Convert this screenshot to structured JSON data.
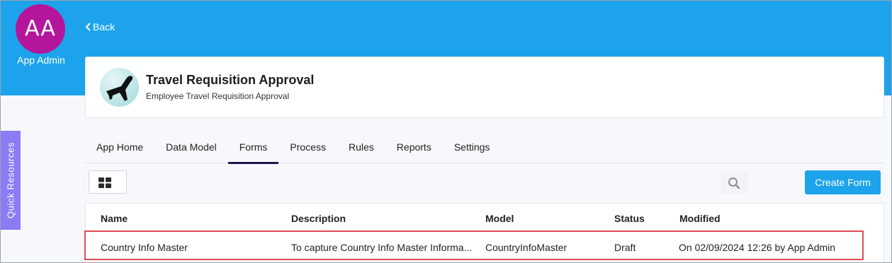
{
  "user": {
    "initials": "AA",
    "name": "App Admin"
  },
  "nav": {
    "back_label": "Back"
  },
  "quick_resources": {
    "label": "Quick Resources"
  },
  "app": {
    "title": "Travel Requisition Approval",
    "subtitle": "Employee Travel Requisition Approval",
    "icon": "airplane-icon"
  },
  "tabs": [
    {
      "label": "App Home",
      "active": false
    },
    {
      "label": "Data Model",
      "active": false
    },
    {
      "label": "Forms",
      "active": true
    },
    {
      "label": "Process",
      "active": false
    },
    {
      "label": "Rules",
      "active": false
    },
    {
      "label": "Reports",
      "active": false
    },
    {
      "label": "Settings",
      "active": false
    }
  ],
  "toolbar": {
    "view_toggle_icon": "grid-view-icon",
    "search_icon": "search-icon",
    "create_label": "Create Form"
  },
  "table": {
    "columns": [
      "Name",
      "Description",
      "Model",
      "Status",
      "Modified"
    ],
    "rows": [
      {
        "name": "Country Info Master",
        "description": "To capture Country Info Master Informa...",
        "model": "CountryInfoMaster",
        "status": "Draft",
        "modified": "On 02/09/2024 12:26 by App Admin"
      }
    ]
  },
  "colors": {
    "header_blue": "#1da3eb",
    "avatar_magenta": "#b4169b",
    "quick_resources_purple": "#8b7cf6",
    "highlight_red": "#e04b55",
    "active_tab_underline": "#1f1a4d"
  }
}
